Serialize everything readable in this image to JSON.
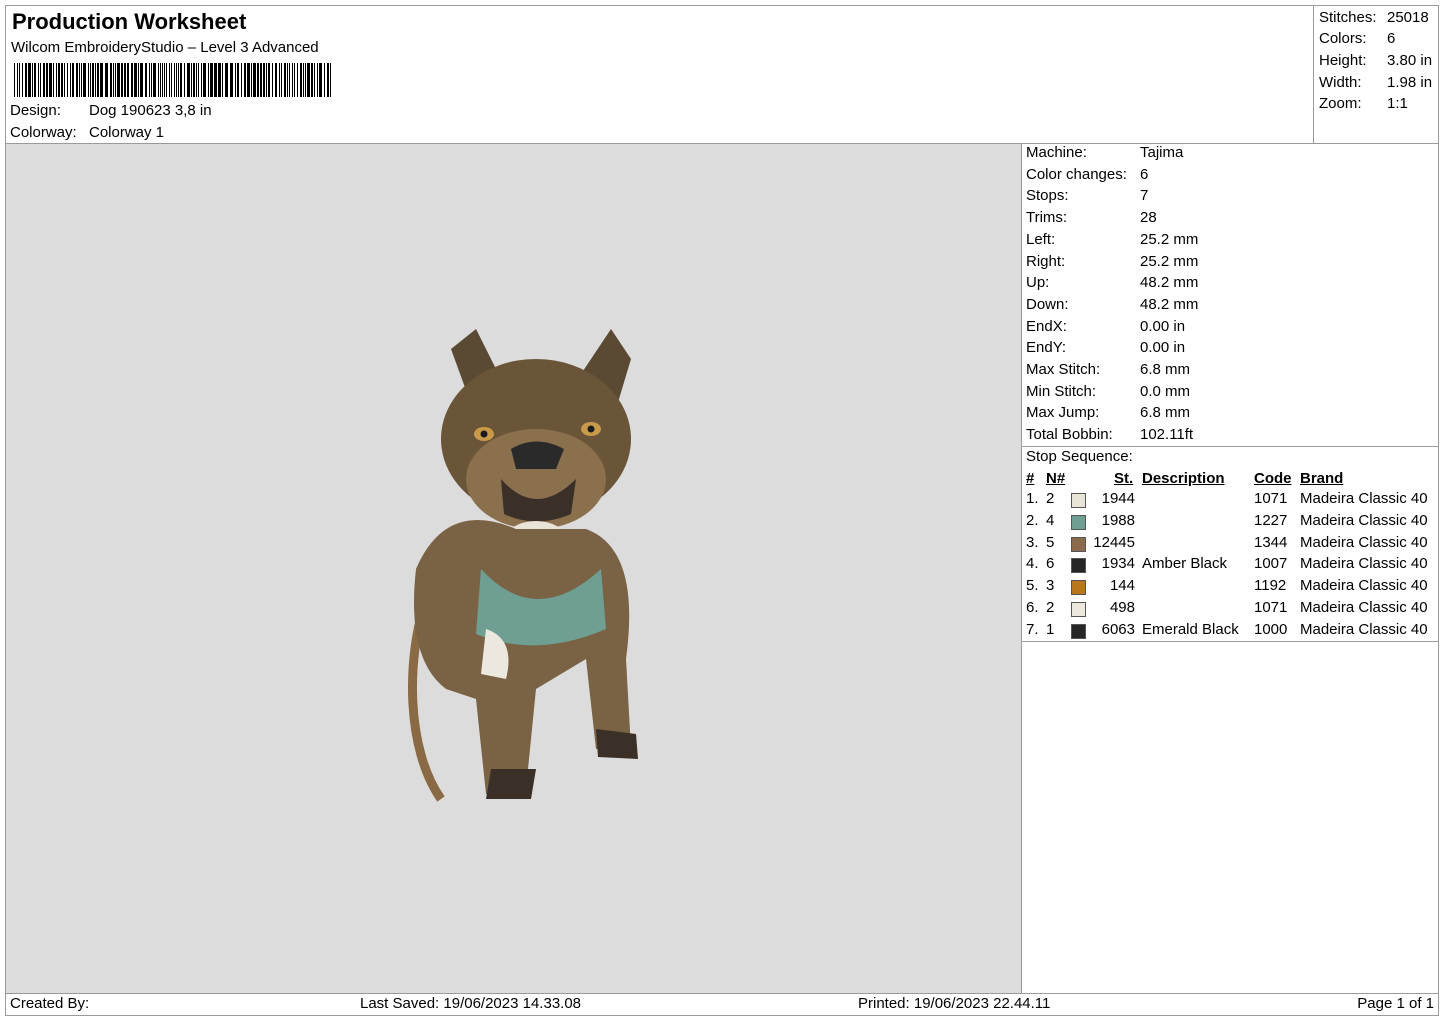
{
  "header": {
    "title": "Production Worksheet",
    "subtitle": "Wilcom EmbroideryStudio – Level 3 Advanced",
    "design_label": "Design:",
    "design_value": "Dog 190623 3,8 in",
    "colorway_label": "Colorway:",
    "colorway_value": "Colorway 1"
  },
  "summary": {
    "stitches_label": "Stitches:",
    "stitches": "25018",
    "colors_label": "Colors:",
    "colors": "6",
    "height_label": "Height:",
    "height": "3.80 in",
    "width_label": "Width:",
    "width": "1.98 in",
    "zoom_label": "Zoom:",
    "zoom": "1:1"
  },
  "machine_info": [
    {
      "label": "Machine:",
      "value": "Tajima"
    },
    {
      "label": "Color changes:",
      "value": "6"
    },
    {
      "label": "Stops:",
      "value": "7"
    },
    {
      "label": "Trims:",
      "value": "28"
    },
    {
      "label": "Left:",
      "value": "25.2 mm"
    },
    {
      "label": "Right:",
      "value": "25.2 mm"
    },
    {
      "label": "Up:",
      "value": "48.2 mm"
    },
    {
      "label": "Down:",
      "value": "48.2 mm"
    },
    {
      "label": "EndX:",
      "value": "0.00 in"
    },
    {
      "label": "EndY:",
      "value": "0.00 in"
    },
    {
      "label": "Max Stitch:",
      "value": "6.8 mm"
    },
    {
      "label": "Min Stitch:",
      "value": "0.0 mm"
    },
    {
      "label": "Max Jump:",
      "value": "6.8 mm"
    },
    {
      "label": "Total Bobbin:",
      "value": "102.11ft"
    }
  ],
  "stop_sequence": {
    "title": "Stop Sequence:",
    "headers": {
      "num": "#",
      "needle": "N#",
      "stitches": "St.",
      "description": "Description",
      "code": "Code",
      "brand": "Brand"
    },
    "rows": [
      {
        "num": "1.",
        "needle": "2",
        "color": "#e8e4d8",
        "stitches": "1944",
        "description": "",
        "code": "1071",
        "brand": "Madeira Classic 40"
      },
      {
        "num": "2.",
        "needle": "4",
        "color": "#6f9e92",
        "stitches": "1988",
        "description": "",
        "code": "1227",
        "brand": "Madeira Classic 40"
      },
      {
        "num": "3.",
        "needle": "5",
        "color": "#8c6a4e",
        "stitches": "12445",
        "description": "",
        "code": "1344",
        "brand": "Madeira Classic 40"
      },
      {
        "num": "4.",
        "needle": "6",
        "color": "#262626",
        "stitches": "1934",
        "description": "Amber Black",
        "code": "1007",
        "brand": "Madeira Classic 40"
      },
      {
        "num": "5.",
        "needle": "3",
        "color": "#b8761e",
        "stitches": "144",
        "description": "",
        "code": "1192",
        "brand": "Madeira Classic 40"
      },
      {
        "num": "6.",
        "needle": "2",
        "color": "#ede8de",
        "stitches": "498",
        "description": "",
        "code": "1071",
        "brand": "Madeira Classic 40"
      },
      {
        "num": "7.",
        "needle": "1",
        "color": "#262626",
        "stitches": "6063",
        "description": "Emerald Black",
        "code": "1000",
        "brand": "Madeira Classic 40"
      }
    ]
  },
  "footer": {
    "created_by": "Created By:",
    "last_saved": "Last Saved: 19/06/2023 14.33.08",
    "printed": "Printed: 19/06/2023 22.44.11",
    "page": "Page 1 of 1"
  },
  "colors": {
    "canvas_bg": "#dcdcdc",
    "border": "#9a9a9a"
  }
}
